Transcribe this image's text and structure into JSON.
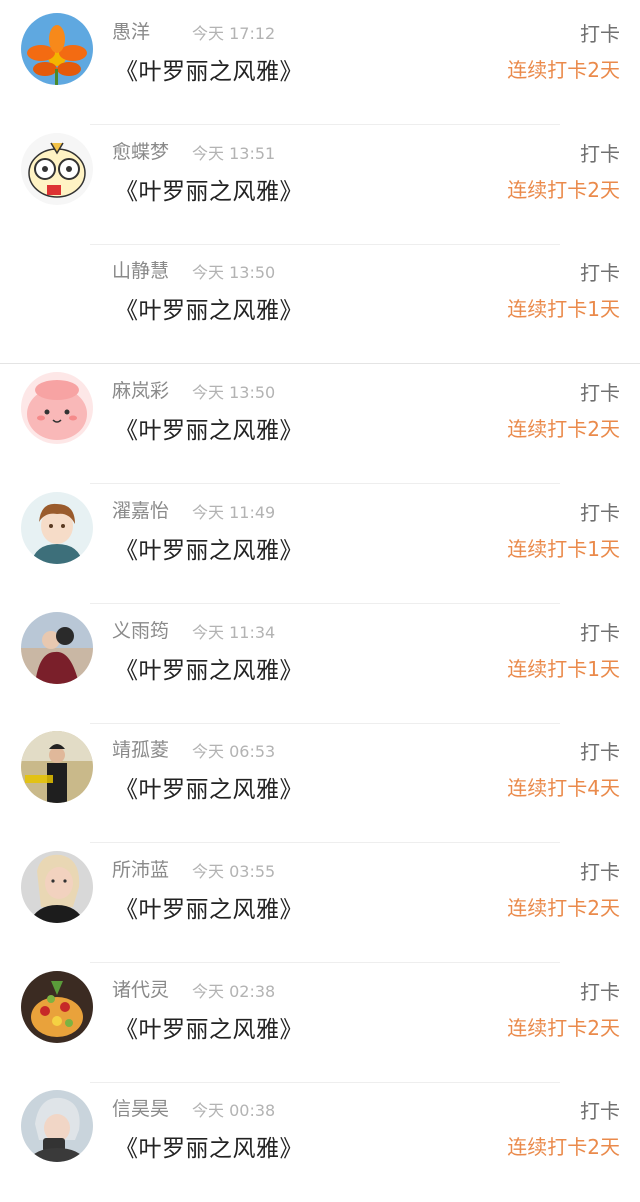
{
  "checkins": [
    {
      "name": "愚洋",
      "time": "今天 17:12",
      "book": "《叶罗丽之风雅》",
      "action": "打卡",
      "streak": "连续打卡2天",
      "avatar": "orange-flower"
    },
    {
      "name": "愈蝶梦",
      "time": "今天 13:51",
      "book": "《叶罗丽之风雅》",
      "action": "打卡",
      "streak": "连续打卡2天",
      "avatar": "cartoon-creature"
    },
    {
      "name": "山静慧",
      "time": "今天 13:50",
      "book": "《叶罗丽之风雅》",
      "action": "打卡",
      "streak": "连续打卡1天",
      "avatar": "none"
    },
    {
      "name": "麻岚彩",
      "time": "今天 13:50",
      "book": "《叶罗丽之风雅》",
      "action": "打卡",
      "streak": "连续打卡2天",
      "avatar": "pink-blob"
    },
    {
      "name": "濯嘉怡",
      "time": "今天 11:49",
      "book": "《叶罗丽之风雅》",
      "action": "打卡",
      "streak": "连续打卡1天",
      "avatar": "anime-boy"
    },
    {
      "name": "义雨筠",
      "time": "今天 11:34",
      "book": "《叶罗丽之风雅》",
      "action": "打卡",
      "streak": "连续打卡1天",
      "avatar": "couple-photo"
    },
    {
      "name": "靖孤菱",
      "time": "今天 06:53",
      "book": "《叶罗丽之风雅》",
      "action": "打卡",
      "streak": "连续打卡4天",
      "avatar": "man-in-field"
    },
    {
      "name": "所沛蓝",
      "time": "今天 03:55",
      "book": "《叶罗丽之风雅》",
      "action": "打卡",
      "streak": "连续打卡2天",
      "avatar": "woman-portrait"
    },
    {
      "name": "诸代灵",
      "time": "今天 02:38",
      "book": "《叶罗丽之风雅》",
      "action": "打卡",
      "streak": "连续打卡2天",
      "avatar": "fruit-cake"
    },
    {
      "name": "信昊昊",
      "time": "今天 00:38",
      "book": "《叶罗丽之风雅》",
      "action": "打卡",
      "streak": "连续打卡2天",
      "avatar": "person-selfie"
    }
  ],
  "colors": {
    "name": "#8a8a8a",
    "time": "#b3b3b3",
    "book": "#222222",
    "action": "#707070",
    "streak": "#ea8a4b"
  }
}
